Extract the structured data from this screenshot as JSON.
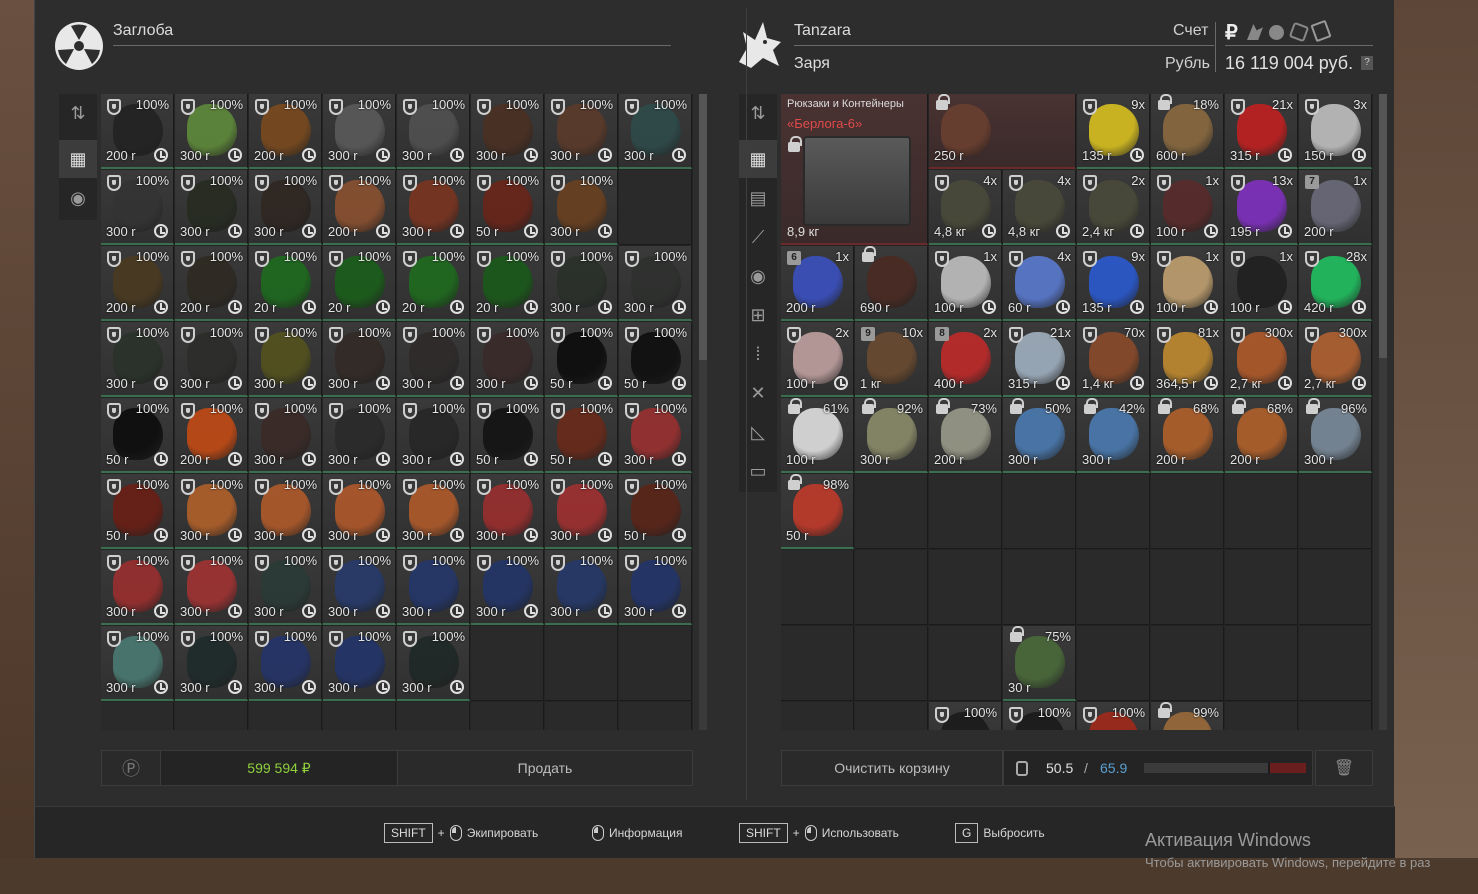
{
  "left_panel": {
    "name": "Заглоба",
    "total": "599 594 ₽",
    "sell_label": "Продать",
    "items": [
      {
        "pct": "100%",
        "price": "200 r",
        "color": "#222"
      },
      {
        "pct": "100%",
        "price": "300 r",
        "color": "#5f8a3a"
      },
      {
        "pct": "100%",
        "price": "200 r",
        "color": "#7a4a1e"
      },
      {
        "pct": "100%",
        "price": "300 r",
        "color": "#5a5a5a"
      },
      {
        "pct": "100%",
        "price": "300 r",
        "color": "#505050"
      },
      {
        "pct": "100%",
        "price": "300 r",
        "color": "#4a2f22"
      },
      {
        "pct": "100%",
        "price": "300 r",
        "color": "#5b3a2a"
      },
      {
        "pct": "100%",
        "price": "300 r",
        "color": "#2e4a4a"
      },
      {
        "pct": "100%",
        "price": "300 r",
        "color": "#333"
      },
      {
        "pct": "100%",
        "price": "300 r",
        "color": "#262b20"
      },
      {
        "pct": "100%",
        "price": "300 r",
        "color": "#2e2621"
      },
      {
        "pct": "100%",
        "price": "200 r",
        "color": "#8a5030"
      },
      {
        "pct": "100%",
        "price": "300 r",
        "color": "#7a3420"
      },
      {
        "pct": "100%",
        "price": "50 r",
        "color": "#6a2418"
      },
      {
        "pct": "100%",
        "price": "300 r",
        "color": "#6a4020"
      },
      null,
      {
        "pct": "100%",
        "price": "200 r",
        "color": "#4a3a20"
      },
      {
        "pct": "100%",
        "price": "200 r",
        "color": "#2e2a22"
      },
      {
        "pct": "100%",
        "price": "20 r",
        "color": "#1d6a1e"
      },
      {
        "pct": "100%",
        "price": "20 r",
        "color": "#1a5e1a"
      },
      {
        "pct": "100%",
        "price": "20 r",
        "color": "#1e6a1e"
      },
      {
        "pct": "100%",
        "price": "20 r",
        "color": "#1a5a1a"
      },
      {
        "pct": "100%",
        "price": "300 r",
        "color": "#2a302a"
      },
      {
        "pct": "100%",
        "price": "300 r",
        "color": "#2e302e"
      },
      {
        "pct": "100%",
        "price": "300 r",
        "color": "#2a322a"
      },
      {
        "pct": "100%",
        "price": "300 r",
        "color": "#2c2c2a"
      },
      {
        "pct": "100%",
        "price": "300 r",
        "color": "#54521e"
      },
      {
        "pct": "100%",
        "price": "300 r",
        "color": "#322a26"
      },
      {
        "pct": "100%",
        "price": "300 r",
        "color": "#2e2a2a"
      },
      {
        "pct": "100%",
        "price": "300 r",
        "color": "#3a2a2a"
      },
      {
        "pct": "100%",
        "price": "50 r",
        "color": "#0c0c0c"
      },
      {
        "pct": "100%",
        "price": "50 r",
        "color": "#0e0e0e"
      },
      {
        "pct": "100%",
        "price": "50 r",
        "color": "#0c0c0c"
      },
      {
        "pct": "100%",
        "price": "200 r",
        "color": "#c24a14"
      },
      {
        "pct": "100%",
        "price": "300 r",
        "color": "#3a2a26"
      },
      {
        "pct": "100%",
        "price": "300 r",
        "color": "#2a2a2a"
      },
      {
        "pct": "100%",
        "price": "300 r",
        "color": "#262626"
      },
      {
        "pct": "100%",
        "price": "50 r",
        "color": "#121212"
      },
      {
        "pct": "100%",
        "price": "50 r",
        "color": "#6a2a1a"
      },
      {
        "pct": "100%",
        "price": "300 r",
        "color": "#9a3030"
      },
      {
        "pct": "100%",
        "price": "50 r",
        "color": "#6a1e14"
      },
      {
        "pct": "100%",
        "price": "300 r",
        "color": "#b0602a"
      },
      {
        "pct": "100%",
        "price": "300 r",
        "color": "#b05a2a"
      },
      {
        "pct": "100%",
        "price": "300 r",
        "color": "#b0582a"
      },
      {
        "pct": "100%",
        "price": "300 r",
        "color": "#b05a2a"
      },
      {
        "pct": "100%",
        "price": "300 r",
        "color": "#9a2e2e"
      },
      {
        "pct": "100%",
        "price": "300 r",
        "color": "#a03030"
      },
      {
        "pct": "100%",
        "price": "50 r",
        "color": "#5a2418"
      },
      {
        "pct": "100%",
        "price": "300 r",
        "color": "#9a2e2e"
      },
      {
        "pct": "100%",
        "price": "300 r",
        "color": "#a03232"
      },
      {
        "pct": "100%",
        "price": "300 r",
        "color": "#2a3a36"
      },
      {
        "pct": "100%",
        "price": "300 r",
        "color": "#263a6a"
      },
      {
        "pct": "100%",
        "price": "300 r",
        "color": "#24366a"
      },
      {
        "pct": "100%",
        "price": "300 r",
        "color": "#223468"
      },
      {
        "pct": "100%",
        "price": "300 r",
        "color": "#243868"
      },
      {
        "pct": "100%",
        "price": "300 r",
        "color": "#22346a"
      },
      {
        "pct": "100%",
        "price": "300 r",
        "color": "#4a7a72"
      },
      {
        "pct": "100%",
        "price": "300 r",
        "color": "#1e2a2a"
      },
      {
        "pct": "100%",
        "price": "300 r",
        "color": "#24346a"
      },
      {
        "pct": "100%",
        "price": "300 r",
        "color": "#22346a"
      },
      {
        "pct": "100%",
        "price": "300 r",
        "color": "#1e2826"
      },
      null,
      null,
      null
    ]
  },
  "right_panel": {
    "name": "Tanzara",
    "faction": "Заря",
    "account_label": "Счет",
    "currency_label": "Рубль",
    "balance": "16 119 004 руб.",
    "balance_help": "?",
    "container": {
      "title": "Рюкзаки и Контейнеры",
      "name": "«Берлога-6»",
      "weight": "8,9 кг"
    },
    "items": [
      {
        "slot": 2,
        "lock": true,
        "pct": "",
        "price": "250 r",
        "color": "#6a4030",
        "wide": true,
        "red": true
      },
      {
        "slot": 4,
        "lock": false,
        "pct": "9x",
        "price": "135 r",
        "color": "#d8c020"
      },
      {
        "slot": 5,
        "lock": true,
        "pct": "18%",
        "price": "600 r",
        "color": "#8a6a40"
      },
      {
        "slot": 6,
        "lock": false,
        "pct": "21x",
        "price": "315 r",
        "color": "#c02020"
      },
      {
        "slot": 7,
        "lock": false,
        "pct": "3x",
        "price": "150 r",
        "color": "#c0c0c0"
      },
      {
        "slot": 10,
        "lock": false,
        "pct": "4x",
        "price": "4,8 кг",
        "color": "#4a4a3a"
      },
      {
        "slot": 11,
        "lock": false,
        "pct": "4x",
        "price": "4,8 кг",
        "color": "#4a4a3a"
      },
      {
        "slot": 12,
        "lock": false,
        "pct": "2x",
        "price": "2,4 кг",
        "color": "#4a4a3a"
      },
      {
        "slot": 13,
        "lock": false,
        "pct": "1x",
        "price": "100 r",
        "color": "#5a2a2a"
      },
      {
        "slot": 14,
        "lock": false,
        "pct": "13x",
        "price": "195 r",
        "color": "#8030c0"
      },
      {
        "slot": 15,
        "badge": "7",
        "pct": "1x",
        "price": "200 r",
        "color": "#6a6a7a"
      },
      {
        "slot": 16,
        "badge": "6",
        "pct": "1x",
        "price": "200 r",
        "color": "#3a50c0"
      },
      {
        "slot": 17,
        "lock": true,
        "pct": "",
        "price": "690 r",
        "color": "#4a2a22"
      },
      {
        "slot": 18,
        "lock": false,
        "pct": "1x",
        "price": "100 r",
        "color": "#c0c0c0"
      },
      {
        "slot": 19,
        "lock": false,
        "pct": "4x",
        "price": "60 r",
        "color": "#5a7ad0"
      },
      {
        "slot": 20,
        "lock": false,
        "pct": "9x",
        "price": "135 r",
        "color": "#2a5ad0"
      },
      {
        "slot": 21,
        "lock": false,
        "pct": "1x",
        "price": "100 r",
        "color": "#c0a070"
      },
      {
        "slot": 22,
        "lock": false,
        "pct": "1x",
        "price": "100 r",
        "color": "#202020"
      },
      {
        "slot": 23,
        "lock": false,
        "pct": "28x",
        "price": "420 r",
        "color": "#20c060"
      },
      {
        "slot": 24,
        "lock": false,
        "pct": "2x",
        "price": "100 r",
        "color": "#c0a0a0"
      },
      {
        "slot": 25,
        "badge": "9",
        "pct": "10x",
        "price": "1 кг",
        "color": "#6a4a30"
      },
      {
        "slot": 26,
        "badge": "8",
        "pct": "2x",
        "price": "400 r",
        "color": "#c02a2a"
      },
      {
        "slot": 27,
        "lock": false,
        "pct": "21x",
        "price": "315 r",
        "color": "#a0b0c0"
      },
      {
        "slot": 28,
        "lock": false,
        "pct": "70x",
        "price": "1,4 кг",
        "color": "#8a4a2a"
      },
      {
        "slot": 29,
        "lock": false,
        "pct": "81x",
        "price": "364,5 r",
        "color": "#c08a30"
      },
      {
        "slot": 30,
        "lock": false,
        "pct": "300x",
        "price": "2,7 кг",
        "color": "#b05a2a"
      },
      {
        "slot": 31,
        "lock": false,
        "pct": "300x",
        "price": "2,7 кг",
        "color": "#b06030"
      },
      {
        "slot": 32,
        "lock": true,
        "pct": "61%",
        "price": "100 r",
        "color": "#e0e0e0"
      },
      {
        "slot": 33,
        "lock": true,
        "pct": "92%",
        "price": "300 r",
        "color": "#8a8a6a"
      },
      {
        "slot": 34,
        "lock": true,
        "pct": "73%",
        "price": "200 r",
        "color": "#9a9a8a"
      },
      {
        "slot": 35,
        "lock": true,
        "pct": "50%",
        "price": "300 r",
        "color": "#4a7ab0"
      },
      {
        "slot": 36,
        "lock": true,
        "pct": "42%",
        "price": "300 r",
        "color": "#4a7ab0"
      },
      {
        "slot": 37,
        "lock": true,
        "pct": "68%",
        "price": "200 r",
        "color": "#b0602a"
      },
      {
        "slot": 38,
        "lock": true,
        "pct": "68%",
        "price": "200 r",
        "color": "#b0602a"
      },
      {
        "slot": 39,
        "lock": true,
        "pct": "96%",
        "price": "300 r",
        "color": "#7a8a9a"
      },
      {
        "slot": 40,
        "lock": true,
        "pct": "98%",
        "price": "50 r",
        "color": "#c03a2a"
      },
      {
        "slot": 59,
        "lock": true,
        "pct": "75%",
        "price": "30 r",
        "color": "#4a6a3a"
      },
      {
        "slot": 66,
        "lock": false,
        "pct": "100%",
        "price": "300 r",
        "color": "#1a1a1a"
      },
      {
        "slot": 67,
        "lock": false,
        "pct": "100%",
        "price": "300 r",
        "color": "#1a1a1a"
      },
      {
        "slot": 68,
        "lock": false,
        "pct": "100%",
        "price": "300 r",
        "color": "#a02a1a"
      },
      {
        "slot": 69,
        "lock": true,
        "pct": "99%",
        "price": "200 r",
        "color": "#9a6a3a"
      }
    ],
    "clear_label": "Очистить корзину",
    "weight_current": "50.5",
    "weight_sep": "/",
    "weight_max": "65.9",
    "weight_fill": 0.766
  },
  "hints": [
    {
      "key": "SHIFT",
      "plus": "+",
      "label": "Экипировать"
    },
    {
      "key": "",
      "plus": "",
      "label": "Информация"
    },
    {
      "key": "SHIFT",
      "plus": "+",
      "label": "Использовать"
    },
    {
      "key": "G",
      "plus": "",
      "label": "Выбросить"
    }
  ],
  "watermark": {
    "title": "Активация Windows",
    "subtitle": "Чтобы активировать Windows, перейдите в раз"
  },
  "colors": {
    "accent_green": "#8fd13c",
    "weight_blue": "#5aa0d0",
    "container_red": "#e04a4a"
  }
}
